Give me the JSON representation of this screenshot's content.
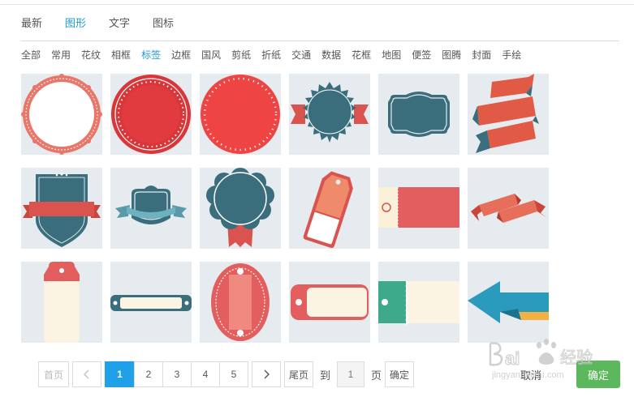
{
  "tabs": [
    {
      "label": "最新",
      "active": false
    },
    {
      "label": "图形",
      "active": true
    },
    {
      "label": "文字",
      "active": false
    },
    {
      "label": "图标",
      "active": false
    }
  ],
  "categories": [
    {
      "label": "全部",
      "active": false
    },
    {
      "label": "常用",
      "active": false
    },
    {
      "label": "花纹",
      "active": false
    },
    {
      "label": "相框",
      "active": false
    },
    {
      "label": "标签",
      "active": true
    },
    {
      "label": "边框",
      "active": false
    },
    {
      "label": "国风",
      "active": false
    },
    {
      "label": "剪纸",
      "active": false
    },
    {
      "label": "折纸",
      "active": false
    },
    {
      "label": "交通",
      "active": false
    },
    {
      "label": "数据",
      "active": false
    },
    {
      "label": "花框",
      "active": false
    },
    {
      "label": "地图",
      "active": false
    },
    {
      "label": "便签",
      "active": false
    },
    {
      "label": "图腾",
      "active": false
    },
    {
      "label": "封面",
      "active": false
    },
    {
      "label": "手绘",
      "active": false
    }
  ],
  "shapes": [
    {
      "name": "shape-tile-scalloped-circle-badge"
    },
    {
      "name": "shape-tile-red-circle-badge"
    },
    {
      "name": "shape-tile-red-dotted-circle"
    },
    {
      "name": "shape-tile-starburst-ribbon-badge"
    },
    {
      "name": "shape-tile-teal-frame-label"
    },
    {
      "name": "shape-tile-folded-ribbon"
    },
    {
      "name": "shape-tile-shield-ribbon"
    },
    {
      "name": "shape-tile-teal-banner-frame"
    },
    {
      "name": "shape-tile-rosette-award"
    },
    {
      "name": "shape-tile-hang-tag-tilted"
    },
    {
      "name": "shape-tile-ticket-label"
    },
    {
      "name": "shape-tile-small-folded-ribbon"
    },
    {
      "name": "shape-tile-tall-hang-tag"
    },
    {
      "name": "shape-tile-slim-bar-label"
    },
    {
      "name": "shape-tile-oval-label"
    },
    {
      "name": "shape-tile-rounded-tag"
    },
    {
      "name": "shape-tile-green-ticket"
    },
    {
      "name": "shape-tile-arrow-banner"
    }
  ],
  "pagination": {
    "first": "首页",
    "prev_icon": "chevron-left-icon",
    "pages": [
      "1",
      "2",
      "3",
      "4",
      "5"
    ],
    "current": "1",
    "next_icon": "chevron-right-icon",
    "last": "尾页",
    "goto_prefix": "到",
    "goto_value": "1",
    "goto_suffix": "页",
    "goto_button": "确定"
  },
  "actions": {
    "cancel": "取消",
    "confirm": "确定"
  },
  "watermark": {
    "text": "Bai经验",
    "sub": "jingyan.baidu.com"
  },
  "colors": {
    "accent": "#1f9ad6",
    "tile_bg": "#e6ebef",
    "red": "#e24a4a",
    "salmon": "#e8776a",
    "teal": "#3b6e7d",
    "cream": "#fbf4e3",
    "confirm": "#5cb85c",
    "pager_active": "#1fa0e8"
  }
}
